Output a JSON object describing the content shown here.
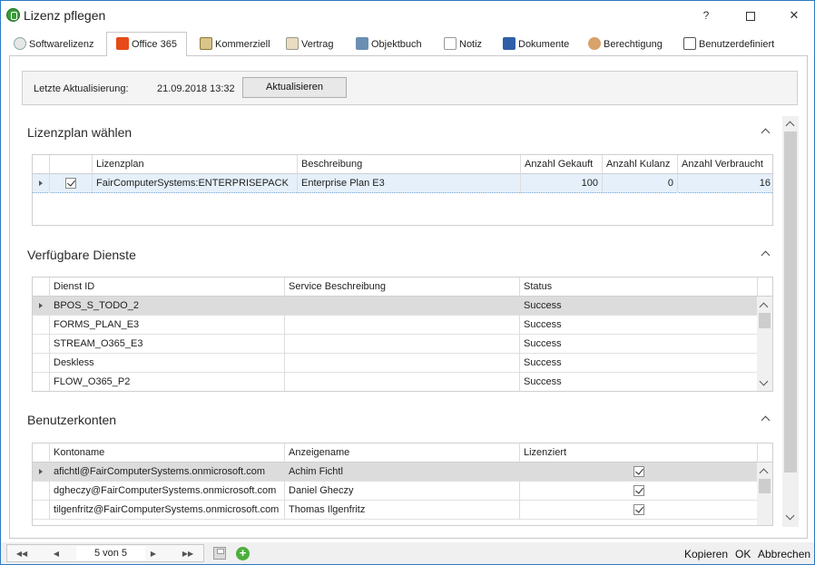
{
  "window": {
    "title": "Lizenz pflegen",
    "help_glyph": "?",
    "maximize_glyph": "",
    "close_glyph": "✕"
  },
  "tabs": [
    {
      "label": "Softwarelizenz",
      "icon": "cd-icon"
    },
    {
      "label": "Office 365",
      "icon": "office-icon"
    },
    {
      "label": "Kommerziell",
      "icon": "calculator-icon"
    },
    {
      "label": "Vertrag",
      "icon": "contract-icon"
    },
    {
      "label": "Objektbuch",
      "icon": "book-icon"
    },
    {
      "label": "Notiz",
      "icon": "note-icon"
    },
    {
      "label": "Dokumente",
      "icon": "document-icon"
    },
    {
      "label": "Berechtigung",
      "icon": "users-icon"
    },
    {
      "label": "Benutzerdefiniert",
      "icon": "list-icon"
    }
  ],
  "status": {
    "label": "Letzte Aktualisierung:",
    "value": "21.09.2018 13:32",
    "refresh_button": "Aktualisieren"
  },
  "license_section": {
    "title": "Lizenzplan wählen",
    "columns": [
      "Lizenzplan",
      "Beschreibung",
      "Anzahl Gekauft",
      "Anzahl Kulanz",
      "Anzahl Verbraucht"
    ],
    "rows": [
      {
        "checked": true,
        "plan": "FairComputerSystems:ENTERPRISEPACK",
        "description": "Enterprise Plan E3",
        "bought": "100",
        "goodwill": "0",
        "used": "16"
      }
    ]
  },
  "services_section": {
    "title": "Verfügbare Dienste",
    "columns": [
      "Dienst ID",
      "Service Beschreibung",
      "Status"
    ],
    "rows": [
      {
        "id": "BPOS_S_TODO_2",
        "description": "",
        "status": "Success"
      },
      {
        "id": "FORMS_PLAN_E3",
        "description": "",
        "status": "Success"
      },
      {
        "id": "STREAM_O365_E3",
        "description": "",
        "status": "Success"
      },
      {
        "id": "Deskless",
        "description": "",
        "status": "Success"
      },
      {
        "id": "FLOW_O365_P2",
        "description": "",
        "status": "Success"
      }
    ]
  },
  "accounts_section": {
    "title": "Benutzerkonten",
    "columns": [
      "Kontoname",
      "Anzeigename",
      "Lizenziert"
    ],
    "rows": [
      {
        "account": "afichtl@FairComputerSystems.onmicrosoft.com",
        "display": "Achim Fichtl",
        "licensed": true
      },
      {
        "account": "dgheczy@FairComputerSystems.onmicrosoft.com",
        "display": "Daniel Gheczy",
        "licensed": true
      },
      {
        "account": "tilgenfritz@FairComputerSystems.onmicrosoft.com",
        "display": "Thomas Ilgenfritz",
        "licensed": true
      }
    ]
  },
  "footer": {
    "record_position": "5 von 5",
    "copy": "Kopieren",
    "ok": "OK",
    "cancel": "Abbrechen"
  },
  "colors": {
    "accent": "#2b78c5",
    "selection": "#e5f0fb",
    "add_green": "#4caf3c"
  }
}
